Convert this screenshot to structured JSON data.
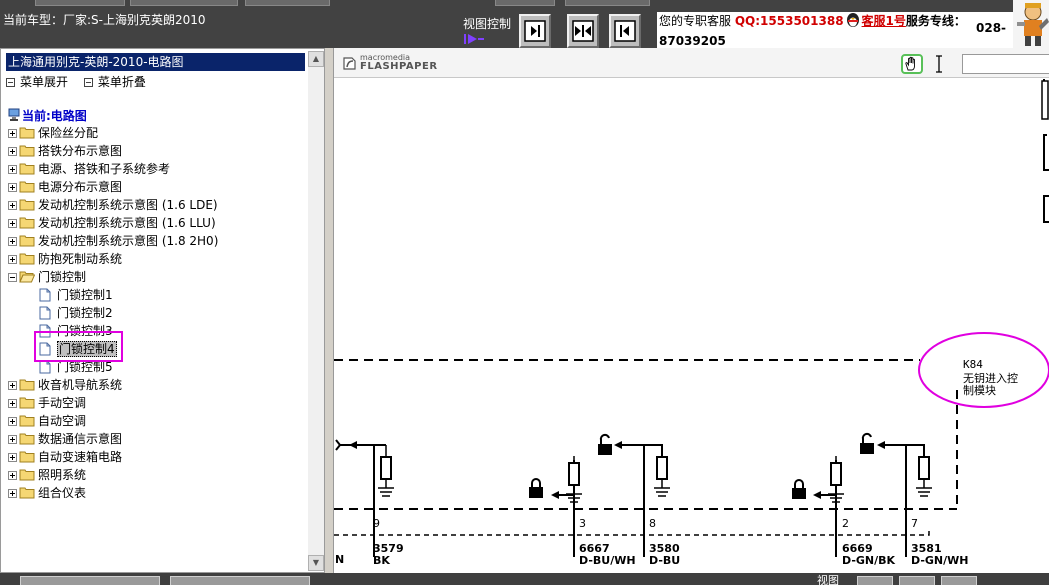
{
  "topbar": {
    "car_model": "当前车型：厂家:S-上海别克英朗2010",
    "view_control_label": "视图控制",
    "support_prefix": "您的专职客服",
    "support_qq": "QQ:1553501388",
    "support_name": "客服1号",
    "support_hotline_label": "服务专线：",
    "support_hotline_1": "028-",
    "support_hotline_2": "87039205"
  },
  "left_panel": {
    "header": "上海通用别克-英朗-2010-电路图",
    "expand_label": "菜单展开",
    "collapse_label": "菜单折叠",
    "current_label": "当前:电路图",
    "tree": [
      {
        "label": "保险丝分配",
        "open": false
      },
      {
        "label": "搭铁分布示意图",
        "open": false
      },
      {
        "label": "电源、搭铁和子系统参考",
        "open": false
      },
      {
        "label": "电源分布示意图",
        "open": false
      },
      {
        "label": "发动机控制系统示意图 (1.6 LDE)",
        "open": false
      },
      {
        "label": "发动机控制系统示意图 (1.6 LLU)",
        "open": false
      },
      {
        "label": "发动机控制系统示意图 (1.8 2H0)",
        "open": false
      },
      {
        "label": "防抱死制动系统",
        "open": false
      },
      {
        "label": "门锁控制",
        "open": true
      }
    ],
    "door_lock_children": [
      "门锁控制1",
      "门锁控制2",
      "门锁控制3",
      "门锁控制4",
      "门锁控制5"
    ],
    "tree_after": [
      {
        "label": "收音机导航系统"
      },
      {
        "label": "手动空调"
      },
      {
        "label": "自动空调"
      },
      {
        "label": "数据通信示意图"
      },
      {
        "label": "自动变速箱电路"
      },
      {
        "label": "照明系统"
      },
      {
        "label": "组合仪表"
      }
    ]
  },
  "viewer": {
    "logo_small": "macromedia",
    "logo_big": "FLASHPAPER"
  },
  "diagram": {
    "module_code": "K84",
    "module_name_1": "无钥进入控",
    "module_name_2": "制模块",
    "pins": [
      "9",
      "3",
      "8",
      "2",
      "7"
    ],
    "wire_codes": [
      "3579",
      "6667",
      "3580",
      "6669",
      "3581"
    ],
    "wire_colors": [
      "BK",
      "D-BU/WH",
      "D-BU",
      "D-GN/BK",
      "D-GN/WH"
    ]
  },
  "bottombar": {
    "view_label": "视图"
  },
  "colors": {
    "highlight": "#e000e0",
    "selection_bar": "#0a246a",
    "tree_current": "#0000c8",
    "support_accent": "#d00000"
  }
}
